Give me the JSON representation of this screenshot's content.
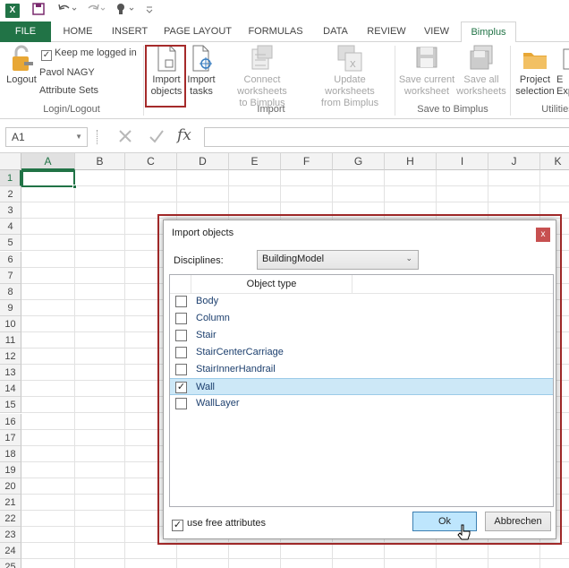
{
  "quick_access": {
    "app_icon": "X"
  },
  "tabs": [
    {
      "label": "FILE"
    },
    {
      "label": "HOME"
    },
    {
      "label": "INSERT"
    },
    {
      "label": "PAGE LAYOUT"
    },
    {
      "label": "FORMULAS"
    },
    {
      "label": "DATA"
    },
    {
      "label": "REVIEW"
    },
    {
      "label": "VIEW"
    },
    {
      "label": "Bimplus"
    }
  ],
  "ribbon": {
    "logout": "Logout",
    "keep_logged_in": "Keep me logged in",
    "user_name": "Pavol NAGY",
    "attribute_sets": "Attribute Sets",
    "import_objects_1": "Import",
    "import_objects_2": "objects",
    "import_tasks_1": "Import",
    "import_tasks_2": "tasks",
    "connect_1": "Connect worksheets",
    "connect_2": "to Bimplus",
    "update_1": "Update worksheets",
    "update_2": "from Bimplus",
    "save_current_1": "Save current",
    "save_current_2": "worksheet",
    "save_all_1": "Save all",
    "save_all_2": "worksheets",
    "project_1": "Project",
    "project_2": "selection",
    "exp_1": "E",
    "exp_2": "Exp",
    "groups": {
      "login": "Login/Logout",
      "import": "Import",
      "save": "Save to Bimplus",
      "utilities": "Utilities"
    }
  },
  "formula_bar": {
    "name_box": "A1",
    "fx": "fx"
  },
  "columns": [
    "A",
    "B",
    "C",
    "D",
    "E",
    "F",
    "G",
    "H",
    "I",
    "J",
    "K"
  ],
  "rows": [
    "1",
    "2",
    "3",
    "4",
    "5",
    "6",
    "7",
    "8",
    "9",
    "10",
    "11",
    "12",
    "13",
    "14",
    "15",
    "16",
    "17",
    "18",
    "19",
    "20",
    "21",
    "22",
    "23",
    "24",
    "25"
  ],
  "dialog": {
    "title": "Import objects",
    "close": "x",
    "disciplines_label": "Disciplines:",
    "disciplines_value": "BuildingModel",
    "column_header": "Object type",
    "items": [
      {
        "label": "Body",
        "checked": false
      },
      {
        "label": "Column",
        "checked": false
      },
      {
        "label": "Stair",
        "checked": false
      },
      {
        "label": "StairCenterCarriage",
        "checked": false
      },
      {
        "label": "StairInnerHandrail",
        "checked": false
      },
      {
        "label": "Wall",
        "checked": true
      },
      {
        "label": "WallLayer",
        "checked": false
      }
    ],
    "free_attributes": "use free attributes",
    "ok": "Ok",
    "cancel": "Abbrechen"
  },
  "colors": {
    "excel_green": "#217346",
    "highlight": "#a52a2a",
    "selection": "#cde8f7"
  }
}
